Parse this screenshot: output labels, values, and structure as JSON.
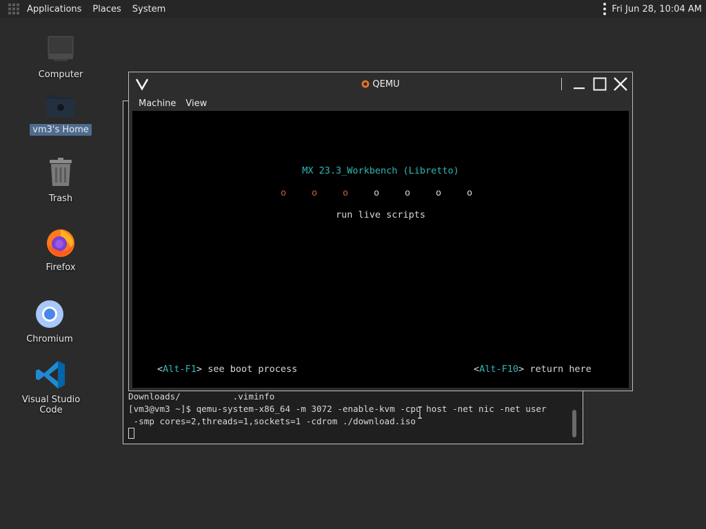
{
  "panel": {
    "menus": [
      "Applications",
      "Places",
      "System"
    ],
    "clock": "Fri Jun 28, 10:04 AM"
  },
  "desktop": {
    "icons": [
      {
        "label": "Computer",
        "icon": "computer-icon"
      },
      {
        "label": "vm3's Home",
        "icon": "home-folder-icon",
        "selected": true
      },
      {
        "label": "Trash",
        "icon": "trash-icon"
      },
      {
        "label": "Firefox",
        "icon": "firefox-icon"
      },
      {
        "label": "Chromium",
        "icon": "chromium-icon"
      },
      {
        "label": "Visual Studio Code",
        "icon": "vscode-icon"
      }
    ]
  },
  "terminal": {
    "lines": [
      "Downloads/          .viminfo",
      "[vm3@vm3 ~]$ qemu-system-x86_64 -m 3072 -enable-kvm -cpu host -net nic -net user",
      " -smp cores=2,threads=1,sockets=1 -cdrom ./download.iso"
    ]
  },
  "qemu": {
    "title": "QEMU",
    "menu": [
      "Machine",
      "View"
    ],
    "screen": {
      "boot_title": "MX 23.3_Workbench (Libretto)",
      "dots": [
        {
          "char": "o",
          "color": "#c8603a"
        },
        {
          "char": "o",
          "color": "#c8603a"
        },
        {
          "char": "o",
          "color": "#c8603a"
        },
        {
          "char": "o",
          "color": "#d8d8d8"
        },
        {
          "char": "o",
          "color": "#d8d8d8"
        },
        {
          "char": "o",
          "color": "#d8d8d8"
        },
        {
          "char": "o",
          "color": "#d8d8d8"
        }
      ],
      "status": "run live scripts",
      "hint_left": {
        "open": "<",
        "key": "Alt-F1",
        "close": ">",
        "text": " see boot process"
      },
      "hint_right": {
        "open": "<",
        "key": "Alt-F10",
        "close": ">",
        "text": " return here"
      }
    }
  },
  "colors": {
    "desktop_bg": "#2b2b2b",
    "accent_cyan": "#33b6b6",
    "progress_done": "#c8603a",
    "selection": "#4f6b8f"
  }
}
